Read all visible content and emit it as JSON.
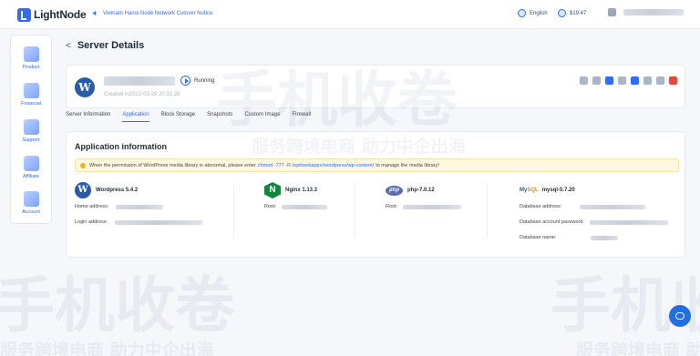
{
  "brand": {
    "name": "LightNode"
  },
  "topbar": {
    "notice": "Vietnam Hanoi Node Network Cutover Notice",
    "language": "English",
    "balance": "$19.47"
  },
  "sidebar": {
    "items": [
      {
        "label": "Product",
        "icon": "product-icon"
      },
      {
        "label": "Financial",
        "icon": "financial-icon"
      },
      {
        "label": "Support",
        "icon": "support-icon"
      },
      {
        "label": "Affiliate",
        "icon": "affiliate-icon"
      },
      {
        "label": "Account",
        "icon": "account-icon"
      }
    ]
  },
  "page": {
    "back_symbol": "<",
    "title": "Server Details"
  },
  "server": {
    "status": "Running",
    "created": "Created in2022-03-29 20:31:28"
  },
  "tabs": [
    "Server Information",
    "Application",
    "Block Storage",
    "Snapshots",
    "Custom Image",
    "Firewall"
  ],
  "app": {
    "title": "Application information",
    "alert": {
      "before": "When the permission of WordPress media library is abnormal, please enter",
      "command": "chmod -777 -R /opt/webapps/wordpress/wp-content/",
      "after": "to manage the media library!"
    },
    "columns": [
      {
        "name": "Wordpress 5.4.2",
        "icon": "wordpress-icon",
        "fields": [
          "Home address:",
          "Login address:"
        ]
      },
      {
        "name": "Nginx 1.13.3",
        "icon": "nginx-icon",
        "fields": [
          "Root:"
        ]
      },
      {
        "name": "php-7.0.12",
        "icon": "php-icon",
        "fields": [
          "Root:"
        ]
      },
      {
        "name": "mysql-5.7.20",
        "icon": "mysql-icon",
        "fields": [
          "Database address:",
          "Database account password:",
          "Database name:"
        ]
      }
    ]
  },
  "colors": {
    "accent": "#2f6bff",
    "danger": "#e5483c",
    "warning_bg": "#fff8e1"
  },
  "watermark": {
    "text": "手机收卷",
    "sub": "服务跨境电商 助力中企出海"
  }
}
